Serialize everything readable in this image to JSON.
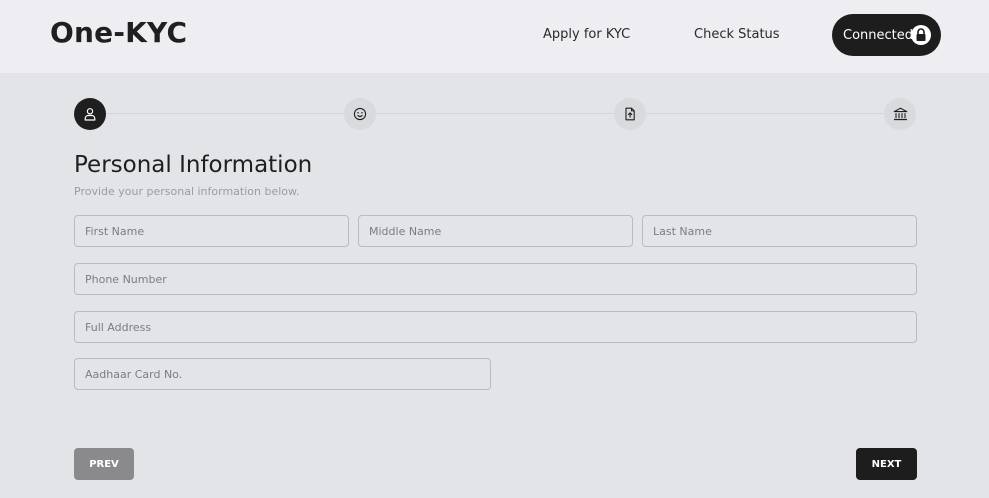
{
  "header": {
    "brand": "One-KYC",
    "nav": {
      "apply": "Apply for KYC",
      "status": "Check Status"
    },
    "connect_label": "Connected",
    "connect_icon": "lock-icon"
  },
  "stepper": {
    "steps": [
      {
        "icon": "user-icon",
        "active": true
      },
      {
        "icon": "smiley-icon",
        "active": false
      },
      {
        "icon": "file-upload-icon",
        "active": false
      },
      {
        "icon": "bank-icon",
        "active": false
      }
    ]
  },
  "form": {
    "title": "Personal Information",
    "subtitle": "Provide your personal information below.",
    "fields": {
      "first_name": {
        "placeholder": "First Name",
        "value": ""
      },
      "middle_name": {
        "placeholder": "Middle Name",
        "value": ""
      },
      "last_name": {
        "placeholder": "Last Name",
        "value": ""
      },
      "phone": {
        "placeholder": "Phone Number",
        "value": ""
      },
      "address": {
        "placeholder": "Full Address",
        "value": ""
      },
      "aadhaar": {
        "placeholder": "Aadhaar Card No.",
        "value": ""
      }
    }
  },
  "actions": {
    "prev": "PREV",
    "next": "NEXT"
  },
  "colors": {
    "background": "#e2e4e7",
    "header_bg": "#eeeef2",
    "primary_dark": "#1d1d1d",
    "prev_button": "#8a8a8c"
  }
}
